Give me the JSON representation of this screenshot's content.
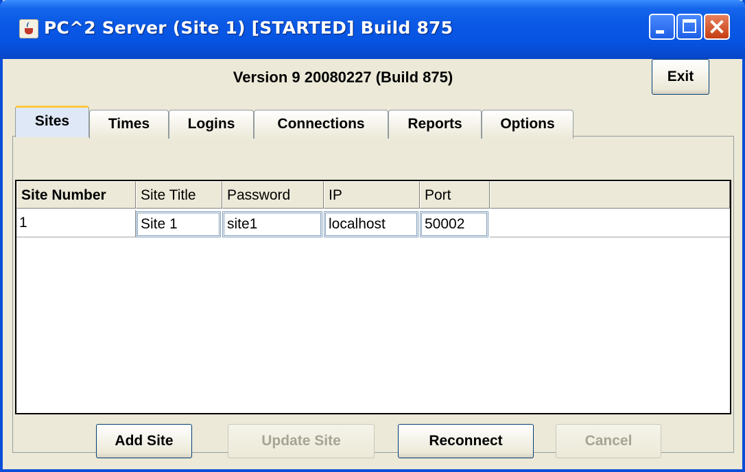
{
  "window": {
    "title": "PC^2 Server (Site 1) [STARTED] Build 875"
  },
  "header": {
    "version_text": "Version 9 20080227 (Build 875)",
    "exit_label": "Exit"
  },
  "tabs": [
    {
      "label": "Sites",
      "active": true
    },
    {
      "label": "Times",
      "active": false
    },
    {
      "label": "Logins",
      "active": false
    },
    {
      "label": "Connections",
      "active": false
    },
    {
      "label": "Reports",
      "active": false
    },
    {
      "label": "Options",
      "active": false
    }
  ],
  "table": {
    "columns": [
      "Site Number",
      "Site Title",
      "Password",
      "IP",
      "Port",
      ""
    ],
    "rows": [
      [
        "1",
        "Site 1",
        "site1",
        "localhost",
        "50002",
        ""
      ]
    ]
  },
  "buttons": {
    "add_site": {
      "label": "Add Site",
      "enabled": true
    },
    "update_site": {
      "label": "Update Site",
      "enabled": false
    },
    "reconnect": {
      "label": "Reconnect",
      "enabled": true
    },
    "cancel": {
      "label": "Cancel",
      "enabled": false
    }
  },
  "colors": {
    "titlebar": "#0a58e4",
    "window_bg": "#ece9d8",
    "active_tab": "#dfe8f6",
    "tab_highlight": "#ffc83c"
  }
}
